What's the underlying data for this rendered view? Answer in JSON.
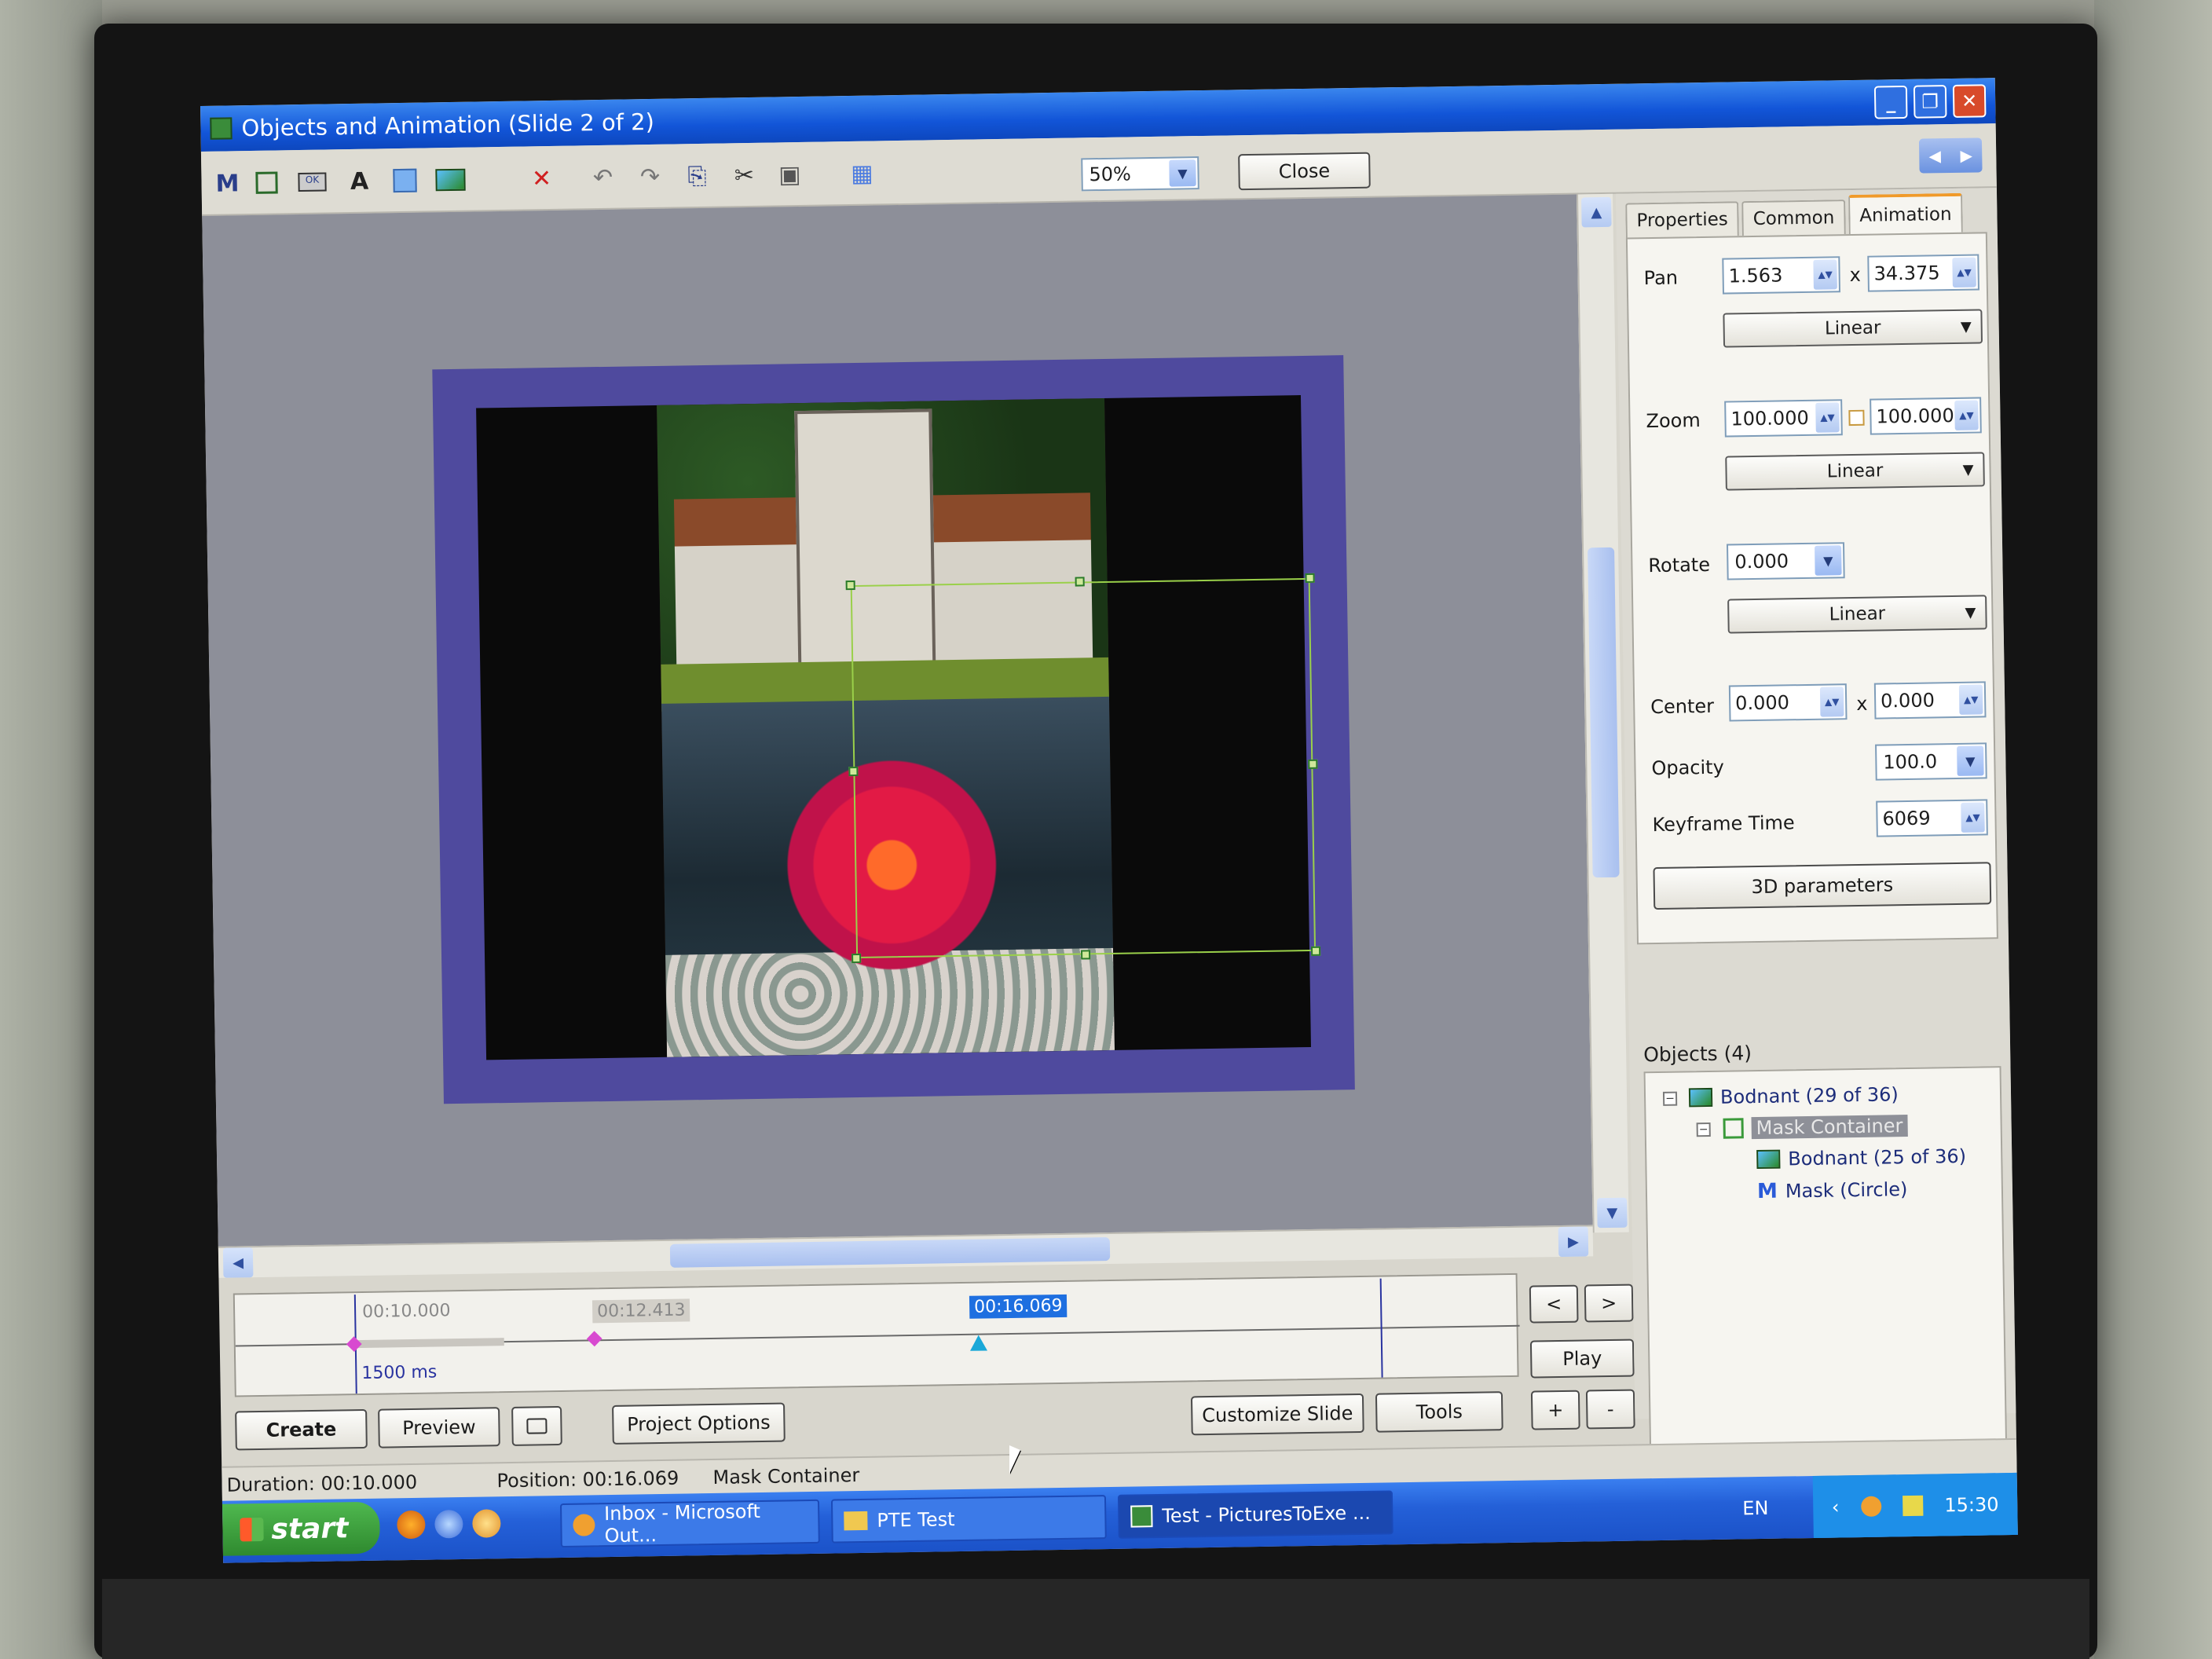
{
  "window": {
    "title": "Objects and Animation  (Slide 2 of 2)"
  },
  "toolbar": {
    "zoom": "50%",
    "close_label": "Close",
    "icons": [
      "mask-icon",
      "rectangle-icon",
      "button-icon",
      "text-icon",
      "frame-icon",
      "image-icon",
      "delete-icon",
      "undo-icon",
      "redo-icon",
      "copy-icon",
      "cut-icon",
      "paste-icon",
      "grid-icon"
    ]
  },
  "timeline": {
    "label_start": "00:10.000",
    "label_mid": "00:12.413",
    "label_current": "00:16.069",
    "duration_label": "1500 ms",
    "prev_label": "<",
    "next_label": ">",
    "play_label": "Play"
  },
  "bottom": {
    "create": "Create",
    "preview": "Preview",
    "project_options": "Project Options",
    "customize_slide": "Customize Slide",
    "tools": "Tools",
    "plus": "+",
    "minus": "-"
  },
  "panel": {
    "tabs": [
      "Properties",
      "Common",
      "Animation"
    ],
    "pan_label": "Pan",
    "pan_x": "1.563",
    "pan_y": "34.375",
    "separator": "x",
    "pan_mode": "Linear",
    "zoom_label": "Zoom",
    "zoom_x": "100.000",
    "zoom_y": "100.000",
    "zoom_mode": "Linear",
    "rotate_label": "Rotate",
    "rotate_value": "0.000",
    "rotate_mode": "Linear",
    "center_label": "Center",
    "center_x": "0.000",
    "center_y": "0.000",
    "opacity_label": "Opacity",
    "opacity_value": "100.0",
    "keyframe_label": "Keyframe Time",
    "keyframe_value": "6069",
    "params_button": "3D parameters"
  },
  "objects": {
    "title": "Objects (4)",
    "items": [
      {
        "label": "Bodnant (29 of 36)",
        "level": 0
      },
      {
        "label": "Mask Container",
        "level": 1
      },
      {
        "label": "Bodnant (25 of 36)",
        "level": 2
      },
      {
        "label": "Mask (Circle)",
        "level": 2
      }
    ]
  },
  "status": {
    "duration": "Duration:  00:10.000",
    "position": "Position:  00:16.069",
    "object": "Mask Container"
  },
  "taskbar": {
    "start": "start",
    "tasks": [
      "Inbox - Microsoft Out...",
      "PTE Test",
      "Test - PicturesToExe ..."
    ],
    "lang": "EN",
    "time": "15:30"
  },
  "colors": {
    "title_bar": "#1255d8",
    "accent_tab": "#f09a2a",
    "selection": "#1e6fe0"
  }
}
